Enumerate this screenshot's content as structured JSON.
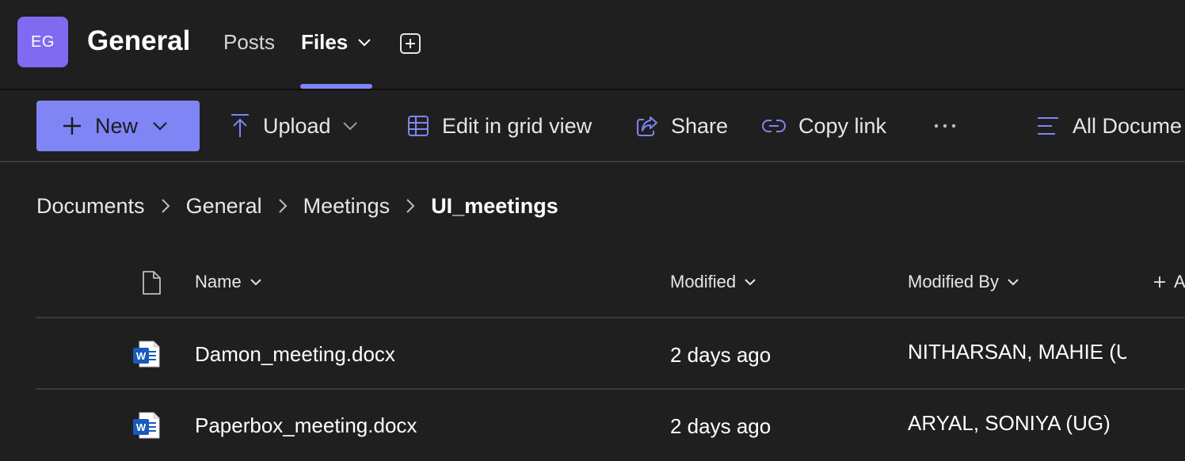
{
  "header": {
    "avatar_initials": "EG",
    "channel_title": "General",
    "tabs": [
      {
        "label": "Posts"
      },
      {
        "label": "Files"
      }
    ],
    "active_tab": "Files"
  },
  "toolbar": {
    "new_label": "New",
    "upload_label": "Upload",
    "grid_label": "Edit in grid view",
    "share_label": "Share",
    "copy_link_label": "Copy link",
    "more_label": "···",
    "view_label": "All Docume"
  },
  "breadcrumb": {
    "items": [
      "Documents",
      "General",
      "Meetings",
      "UI_meetings"
    ]
  },
  "table": {
    "columns": {
      "name": "Name",
      "modified": "Modified",
      "modified_by": "Modified By",
      "add_column": "Ad"
    },
    "rows": [
      {
        "icon": "word-doc-icon",
        "name": "Damon_meeting.docx",
        "modified": "2 days ago",
        "modified_by": "NITHARSAN, MAHIE (U"
      },
      {
        "icon": "word-doc-icon",
        "name": "Paperbox_meeting.docx",
        "modified": "2 days ago",
        "modified_by": "ARYAL, SONIYA (UG)"
      }
    ]
  },
  "colors": {
    "background": "#1f1f1f",
    "accent": "#7f85f5",
    "avatar": "#7f6af0",
    "word_blue": "#185abd"
  }
}
